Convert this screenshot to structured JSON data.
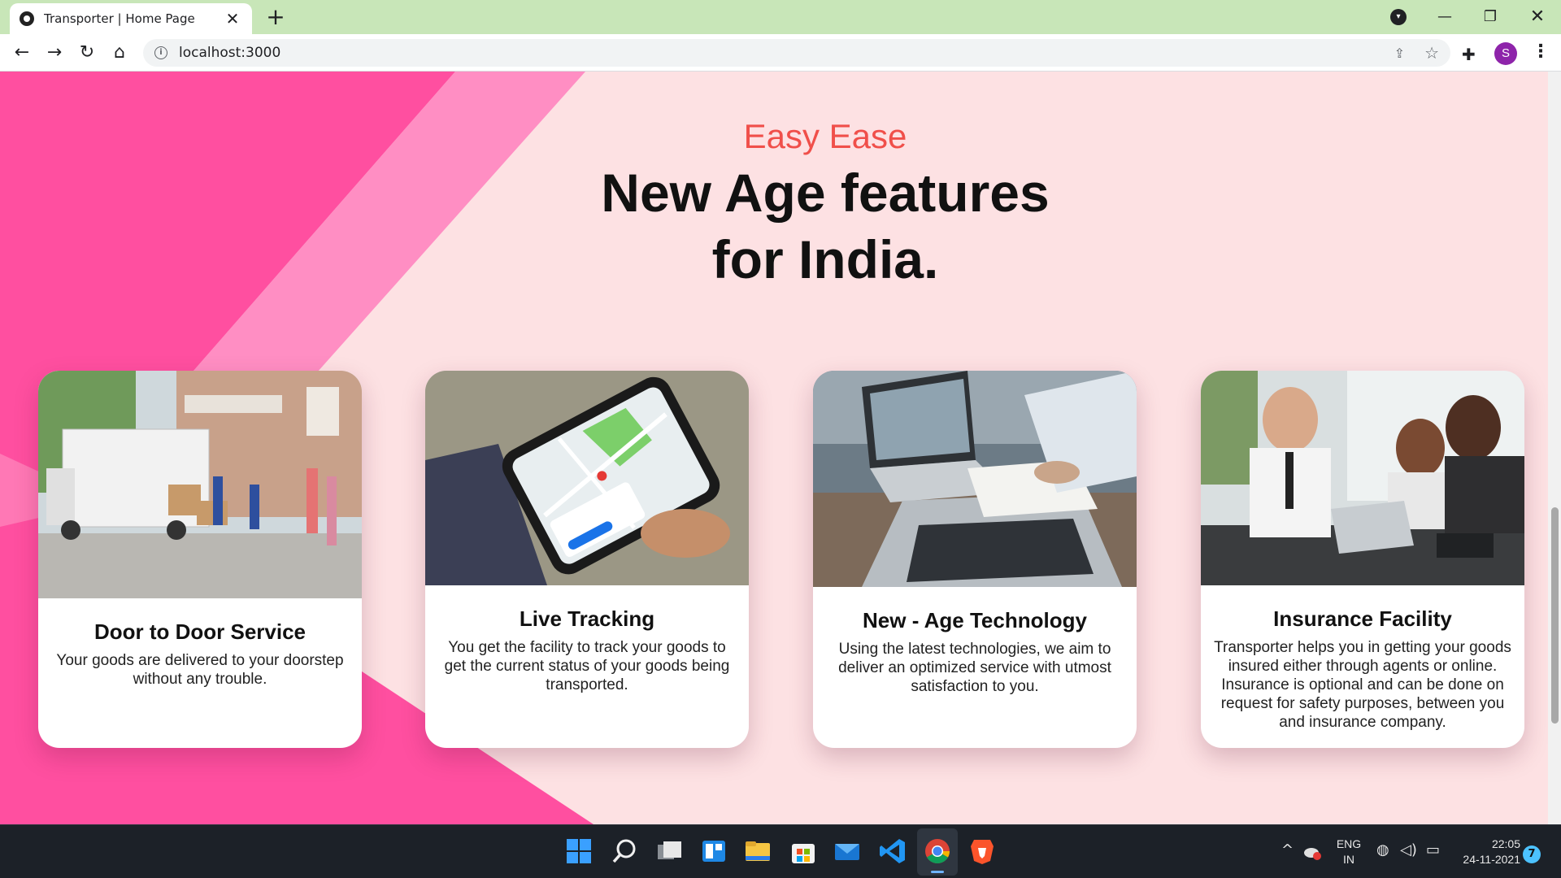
{
  "browser": {
    "tab_title": "Transporter | Home Page",
    "tab_close": "✕",
    "new_tab": "+",
    "url": "localhost:3000",
    "profile_initial": "S"
  },
  "hero": {
    "eyebrow": "Easy Ease",
    "heading_line1": "New Age features",
    "heading_line2": "for India."
  },
  "features": [
    {
      "title": "Door to Door Service",
      "description": "Your goods are delivered to your doorstep without any trouble.",
      "image": "moving-truck-photo"
    },
    {
      "title": "Live Tracking",
      "description": "You get the facility to track your goods to get the current status of your goods being transported.",
      "image": "phone-map-photo"
    },
    {
      "title": "New - Age Technology",
      "description": "Using the latest technologies, we aim to deliver an optimized service with utmost satisfaction to you.",
      "image": "laptop-work-photo"
    },
    {
      "title": "Insurance Facility",
      "description": "Transporter helps you in getting your goods insured either through agents or online. Insurance is optional and can be done on request for safety purposes, between you and insurance company.",
      "image": "insurance-meeting-photo"
    }
  ],
  "taskbar": {
    "language_line1": "ENG",
    "language_line2": "IN",
    "time": "22:05",
    "date": "24-11-2021",
    "notification_count": "7"
  },
  "colors": {
    "page_bg": "#fde1e3",
    "accent_pink": "#ff4fa0",
    "eyebrow_red": "#f04f4a",
    "tab_strip": "#c8e6b8"
  }
}
